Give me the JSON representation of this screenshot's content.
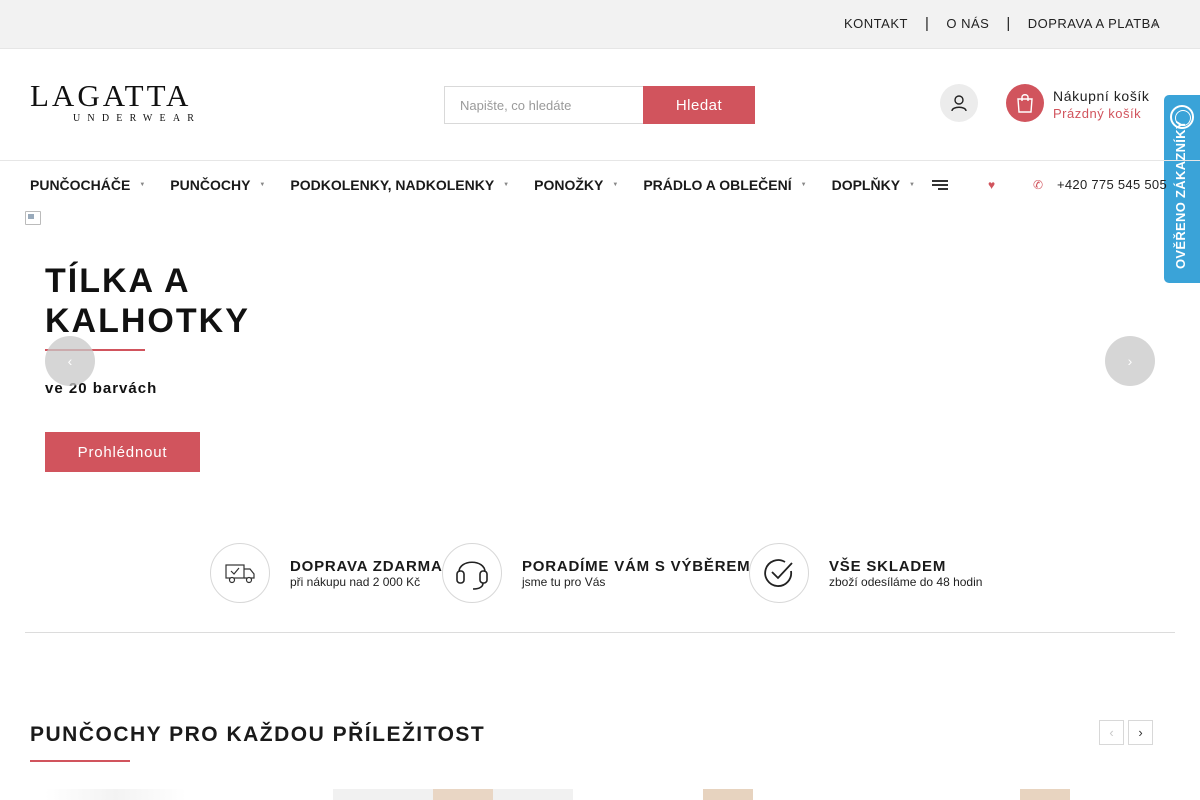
{
  "topbar": {
    "links": [
      "KONTAKT",
      "O NÁS",
      "DOPRAVA A PLATBA"
    ],
    "separator": "|"
  },
  "header": {
    "logo_word": "LAGATTA",
    "logo_sub": "UNDERWEAR",
    "search_placeholder": "Napište, co hledáte",
    "search_button": "Hledat",
    "account_icon": "user-icon",
    "cart_icon": "shopping-bag-icon",
    "cart_title": "Nákupní košík",
    "cart_status": "Prázdný košík"
  },
  "trust_badge": {
    "text": "OVĚŘENO ZÁKAZNÍKY"
  },
  "nav": {
    "items": [
      {
        "label": "PUNČOCHÁČE"
      },
      {
        "label": "PUNČOCHY"
      },
      {
        "label": "PODKOLENKY, NADKOLENKY"
      },
      {
        "label": "PONOŽKY"
      },
      {
        "label": "PRÁDLO A OBLEČENÍ"
      },
      {
        "label": "DOPLŇKY"
      }
    ],
    "phone": "+420 775 545 505"
  },
  "hero": {
    "title": "TÍLKA A KALHOTKY",
    "subtitle": "ve 20 barvách",
    "button": "Prohlédnout"
  },
  "features": [
    {
      "icon": "truck-icon",
      "title": "DOPRAVA ZDARMA",
      "subtitle": "při nákupu nad 2 000 Kč"
    },
    {
      "icon": "headset-icon",
      "title": "PORADÍME VÁM S VÝBĚREM",
      "subtitle": "jsme tu pro Vás"
    },
    {
      "icon": "checkmark-circle-icon",
      "title": "VŠE SKLADEM",
      "subtitle": "zboží odesíláme do 48 hodin"
    }
  ],
  "section": {
    "title": "PUNČOCHY PRO KAŽDOU PŘÍLEŽITOST"
  },
  "colors": {
    "accent": "#d1545d",
    "badge": "#3aa3d8",
    "topbar_bg": "#f2f2f2"
  }
}
